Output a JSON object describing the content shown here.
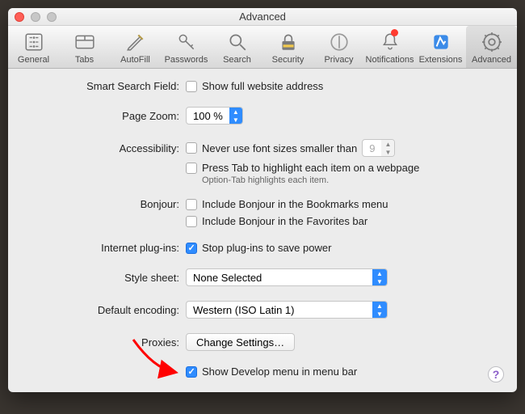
{
  "window": {
    "title": "Advanced"
  },
  "toolbar": [
    {
      "key": "general",
      "label": "General"
    },
    {
      "key": "tabs",
      "label": "Tabs"
    },
    {
      "key": "autofill",
      "label": "AutoFill"
    },
    {
      "key": "passwords",
      "label": "Passwords"
    },
    {
      "key": "search",
      "label": "Search"
    },
    {
      "key": "security",
      "label": "Security"
    },
    {
      "key": "privacy",
      "label": "Privacy"
    },
    {
      "key": "notifications",
      "label": "Notifications"
    },
    {
      "key": "extensions",
      "label": "Extensions"
    },
    {
      "key": "advanced",
      "label": "Advanced"
    }
  ],
  "labels": {
    "smart_search": "Smart Search Field:",
    "page_zoom": "Page Zoom:",
    "accessibility": "Accessibility:",
    "bonjour": "Bonjour:",
    "plugins": "Internet plug-ins:",
    "stylesheet": "Style sheet:",
    "encoding": "Default encoding:",
    "proxies": "Proxies:"
  },
  "smart_search": {
    "show_full": "Show full website address"
  },
  "page_zoom": {
    "value": "100 %"
  },
  "accessibility": {
    "never_smaller": "Never use font sizes smaller than",
    "min_font": "9",
    "press_tab": "Press Tab to highlight each item on a webpage",
    "hint": "Option-Tab highlights each item."
  },
  "bonjour": {
    "bookmarks": "Include Bonjour in the Bookmarks menu",
    "favorites": "Include Bonjour in the Favorites bar"
  },
  "plugins": {
    "stop_to_save": "Stop plug-ins to save power"
  },
  "stylesheet": {
    "value": "None Selected"
  },
  "encoding": {
    "value": "Western (ISO Latin 1)"
  },
  "proxies": {
    "button": "Change Settings…"
  },
  "develop": {
    "label": "Show Develop menu in menu bar"
  }
}
